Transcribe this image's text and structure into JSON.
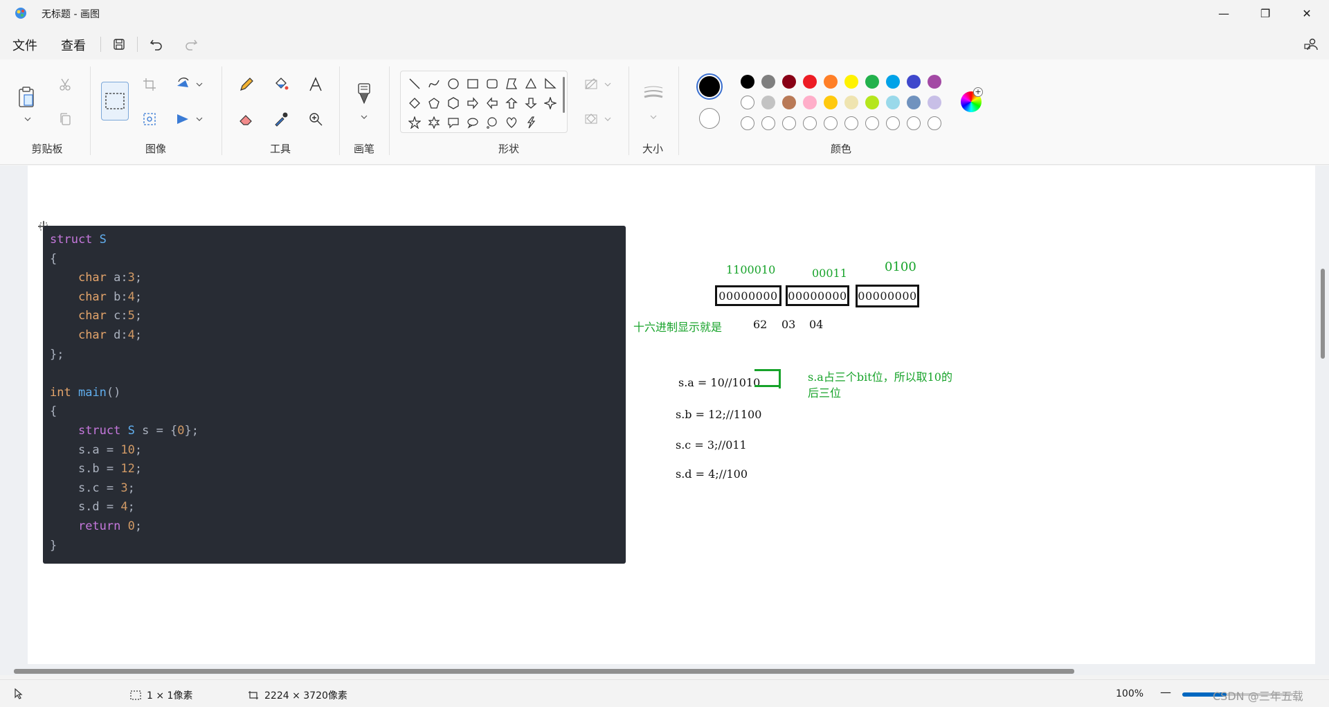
{
  "window": {
    "title": "无标题 - 画图",
    "minimize_glyph": "—",
    "restore_glyph": "❐",
    "close_glyph": "✕"
  },
  "menu": {
    "file": "文件",
    "view": "查看"
  },
  "ribbon": {
    "groups": {
      "clipboard": "剪贴板",
      "image": "图像",
      "tools": "工具",
      "brushes": "画笔",
      "shapes": "形状",
      "size": "大小",
      "colors": "颜色"
    },
    "colors": {
      "row1": [
        "#000000",
        "#7f7f7f",
        "#880015",
        "#ed1c24",
        "#ff7f27",
        "#fff200",
        "#22b14c",
        "#00a2e8",
        "#3f48cc",
        "#a349a4"
      ],
      "row2": [
        "#ffffff",
        "#c3c3c3",
        "#b97a57",
        "#ffaec9",
        "#ffc90e",
        "#efe4b0",
        "#b5e61d",
        "#99d9ea",
        "#7092be",
        "#c8bfe7"
      ],
      "color1": "#000000",
      "color2": "#ffffff"
    }
  },
  "code": {
    "lines": [
      [
        {
          "c": "kw",
          "t": "struct"
        },
        {
          "c": "",
          "t": " "
        },
        {
          "c": "nm",
          "t": "S"
        }
      ],
      [
        {
          "c": "",
          "t": "{"
        }
      ],
      [
        {
          "c": "",
          "t": "    "
        },
        {
          "c": "ty",
          "t": "char"
        },
        {
          "c": "",
          "t": " a:"
        },
        {
          "c": "num",
          "t": "3"
        },
        {
          "c": "",
          "t": ";"
        }
      ],
      [
        {
          "c": "",
          "t": "    "
        },
        {
          "c": "ty",
          "t": "char"
        },
        {
          "c": "",
          "t": " b:"
        },
        {
          "c": "num",
          "t": "4"
        },
        {
          "c": "",
          "t": ";"
        }
      ],
      [
        {
          "c": "",
          "t": "    "
        },
        {
          "c": "ty",
          "t": "char"
        },
        {
          "c": "",
          "t": " c:"
        },
        {
          "c": "num",
          "t": "5"
        },
        {
          "c": "",
          "t": ";"
        }
      ],
      [
        {
          "c": "",
          "t": "    "
        },
        {
          "c": "ty",
          "t": "char"
        },
        {
          "c": "",
          "t": " d:"
        },
        {
          "c": "num",
          "t": "4"
        },
        {
          "c": "",
          "t": ";"
        }
      ],
      [
        {
          "c": "",
          "t": "};"
        }
      ],
      [
        {
          "c": "",
          "t": ""
        }
      ],
      [
        {
          "c": "ty",
          "t": "int"
        },
        {
          "c": "",
          "t": " "
        },
        {
          "c": "nm",
          "t": "main"
        },
        {
          "c": "",
          "t": "()"
        }
      ],
      [
        {
          "c": "",
          "t": "{"
        }
      ],
      [
        {
          "c": "",
          "t": "    "
        },
        {
          "c": "kw",
          "t": "struct"
        },
        {
          "c": "",
          "t": " "
        },
        {
          "c": "nm",
          "t": "S"
        },
        {
          "c": "",
          "t": " s = {"
        },
        {
          "c": "num",
          "t": "0"
        },
        {
          "c": "",
          "t": "};"
        }
      ],
      [
        {
          "c": "",
          "t": "    s.a = "
        },
        {
          "c": "num",
          "t": "10"
        },
        {
          "c": "",
          "t": ";"
        }
      ],
      [
        {
          "c": "",
          "t": "    s.b = "
        },
        {
          "c": "num",
          "t": "12"
        },
        {
          "c": "",
          "t": ";"
        }
      ],
      [
        {
          "c": "",
          "t": "    s.c = "
        },
        {
          "c": "num",
          "t": "3"
        },
        {
          "c": "",
          "t": ";"
        }
      ],
      [
        {
          "c": "",
          "t": "    s.d = "
        },
        {
          "c": "num",
          "t": "4"
        },
        {
          "c": "",
          "t": ";"
        }
      ],
      [
        {
          "c": "",
          "t": "    "
        },
        {
          "c": "kw",
          "t": "return"
        },
        {
          "c": "",
          "t": " "
        },
        {
          "c": "num",
          "t": "0"
        },
        {
          "c": "",
          "t": ";"
        }
      ],
      [
        {
          "c": "",
          "t": "}"
        }
      ]
    ]
  },
  "annotations": {
    "bits_top": [
      "1100010",
      "00011",
      "0100"
    ],
    "boxes": [
      "00000000",
      "00000000",
      "00000000"
    ],
    "hex_label": "十六进制显示就是",
    "hex_values": [
      "62",
      "03",
      "04"
    ],
    "sa_line": "s.a = 10//1010",
    "sa_note_1": "s.a占三个bit位，所以取10的",
    "sa_note_2": "后三位",
    "sb_line": "s.b = 12;//1100",
    "sc_line": "s.c = 3;//011",
    "sd_line": "s.d = 4;//100"
  },
  "status": {
    "selection": "1 × 1像素",
    "canvas_size": "2224 × 3720像素",
    "zoom": "100%",
    "zoom_minus": "—",
    "zoom_level": 0.4,
    "watermark": "CSDN @三年五载"
  }
}
